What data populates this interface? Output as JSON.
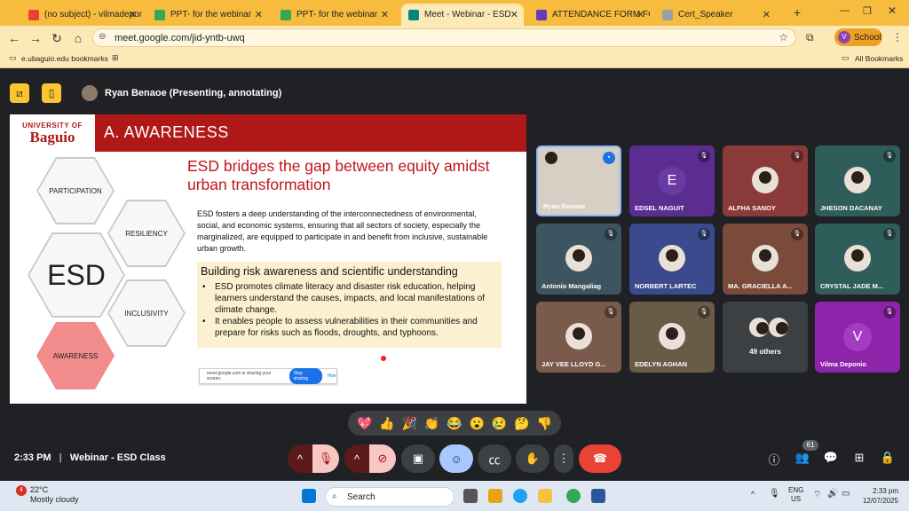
{
  "browser": {
    "tabs": [
      {
        "title": "(no subject) - vilmadeponi",
        "color": "#ea4335"
      },
      {
        "title": "PPT- for the webinar",
        "color": "#34a853"
      },
      {
        "title": "PPT- for the webinar",
        "color": "#34a853"
      },
      {
        "title": "Meet - Webinar - ESD",
        "color": "#00897b",
        "active": true
      },
      {
        "title": "ATTENDANCE FORM FOR",
        "color": "#673ab7"
      },
      {
        "title": "Cert_Speaker",
        "color": "#9aa0a6"
      }
    ],
    "url": "meet.google.com/jid-yntb-uwq",
    "profile_label": "School",
    "profile_initial": "V",
    "bookmark": "e.ubaguio.edu bookmarks",
    "all_bookmarks": "All Bookmarks"
  },
  "meet": {
    "presenter_label": "Ryan Benaoe (Presenting, annotating)",
    "time": "2:33 PM",
    "meeting_name": "Webinar - ESD Class",
    "participant_count": "61",
    "reactions": [
      "💖",
      "👍",
      "🎉",
      "👏",
      "😂",
      "😮",
      "😢",
      "🤔",
      "👎"
    ]
  },
  "slide": {
    "logo_top": "UNIVERSITY OF",
    "logo_main": "Baguio",
    "section": "A. AWARENESS",
    "heading": "ESD bridges the gap between equity amidst urban transformation",
    "paragraph": "ESD fosters a deep understanding of the interconnectedness of environmental, social, and economic systems, ensuring that all sectors of society, especially the marginalized, are equipped to participate in and benefit from inclusive, sustainable urban growth.",
    "box_title": "Building risk awareness and scientific understanding",
    "bullets": [
      "ESD promotes climate literacy and disaster risk education, helping learners understand the causes, impacts, and local manifestations of climate change.",
      "It enables people to assess vulnerabilities in their communities and prepare for risks such as floods, droughts, and typhoons."
    ],
    "hexagons": {
      "participation": "PARTICIPATION",
      "resiliency": "RESILIENCY",
      "esd": "ESD",
      "inclusivity": "INCLUSIVITY",
      "awareness": "AWARENESS"
    },
    "share_text": "meet.google.com is sharing your screen.",
    "stop_label": "Stop sharing",
    "hide_label": "Hide"
  },
  "participants": [
    {
      "name": "Ryan Benaoe",
      "bg": "#c9b9a5",
      "type": "photo"
    },
    {
      "name": "EDSEL NAGUIT",
      "bg": "#5b2d90",
      "type": "letter",
      "letter": "E",
      "circle": "#6a3aa3"
    },
    {
      "name": "ALFHA SANOY",
      "bg": "#8b3a3a",
      "type": "photo"
    },
    {
      "name": "JHESON DACANAY",
      "bg": "#2e5d5a",
      "type": "photo"
    },
    {
      "name": "Antonio Mangaliag",
      "bg": "#3d5560",
      "type": "photo"
    },
    {
      "name": "NORBERT LARTEC",
      "bg": "#3a4a8c",
      "type": "photo"
    },
    {
      "name": "MA. GRACIELLA A...",
      "bg": "#7a4a3a",
      "type": "photo"
    },
    {
      "name": "CRYSTAL JADE M...",
      "bg": "#2e5d5a",
      "type": "photo"
    },
    {
      "name": "JAY VEE LLOYD G...",
      "bg": "#7a5a4a",
      "type": "photo"
    },
    {
      "name": "EDELYN AGHAN",
      "bg": "#6a5a48",
      "type": "photo"
    },
    {
      "name": "49 others",
      "bg": "#3c4043",
      "type": "others"
    },
    {
      "name": "Vilma Deponio",
      "bg": "#8e24aa",
      "type": "letter",
      "letter": "V",
      "circle": "#a33cc0"
    }
  ],
  "taskbar": {
    "temp": "22°C",
    "weather": "Mostly cloudy",
    "search": "Search",
    "lang1": "ENG",
    "lang2": "US",
    "time": "2:33 pm",
    "date": "12/07/2025",
    "notif": "4"
  }
}
